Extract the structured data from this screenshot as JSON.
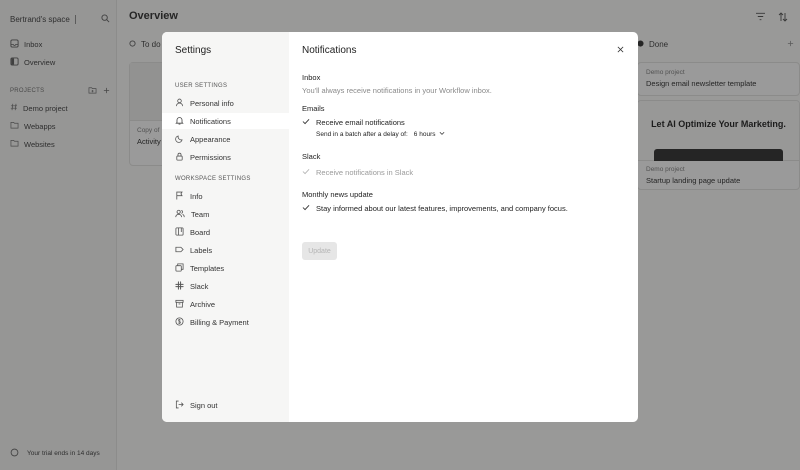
{
  "workspace": {
    "name": "Bertrand's space"
  },
  "sidebar": {
    "items": [
      {
        "label": "Inbox",
        "icon": "inbox-icon"
      },
      {
        "label": "Overview",
        "icon": "overview-icon"
      }
    ],
    "projects_header": "PROJECTS",
    "projects": [
      {
        "label": "Demo project",
        "icon": "hash-icon"
      },
      {
        "label": "Webapps",
        "icon": "folder-icon"
      },
      {
        "label": "Websites",
        "icon": "folder-icon"
      }
    ],
    "trial": "Your trial ends in 14 days"
  },
  "main": {
    "title": "Overview",
    "columns": [
      {
        "label": "To do"
      },
      {
        "label": "Done"
      }
    ],
    "cards": [
      {
        "project": "Copy of",
        "title": "Activity"
      },
      {
        "project": "Demo project",
        "title": "Design email newsletter template"
      },
      {
        "project": "Demo project",
        "title": "Startup landing page update",
        "hero": "Let AI Optimize Your Marketing."
      }
    ]
  },
  "settings": {
    "title": "Settings",
    "user_group": "USER SETTINGS",
    "user_items": [
      {
        "label": "Personal info",
        "icon": "user-icon"
      },
      {
        "label": "Notifications",
        "icon": "bell-icon",
        "active": true
      },
      {
        "label": "Appearance",
        "icon": "moon-icon"
      },
      {
        "label": "Permissions",
        "icon": "lock-icon"
      }
    ],
    "workspace_group": "WORKSPACE SETTINGS",
    "workspace_items": [
      {
        "label": "Info",
        "icon": "flag-icon"
      },
      {
        "label": "Team",
        "icon": "team-icon"
      },
      {
        "label": "Board",
        "icon": "board-icon"
      },
      {
        "label": "Labels",
        "icon": "label-icon"
      },
      {
        "label": "Templates",
        "icon": "templates-icon"
      },
      {
        "label": "Slack",
        "icon": "slack-icon"
      },
      {
        "label": "Archive",
        "icon": "archive-icon"
      },
      {
        "label": "Billing & Payment",
        "icon": "billing-icon"
      }
    ],
    "sign_out": "Sign out"
  },
  "notifications": {
    "title": "Notifications",
    "inbox": {
      "label": "Inbox",
      "desc": "You'll always receive notifications in your Workflow inbox."
    },
    "emails": {
      "label": "Emails",
      "option": "Receive email notifications",
      "delay_label": "Send in a batch after a delay of:",
      "delay_value": "6 hours"
    },
    "slack": {
      "label": "Slack",
      "option": "Receive notifications in Slack"
    },
    "news": {
      "label": "Monthly news update",
      "option": "Stay informed about our latest features, improvements, and company focus."
    },
    "update_button": "Update"
  }
}
